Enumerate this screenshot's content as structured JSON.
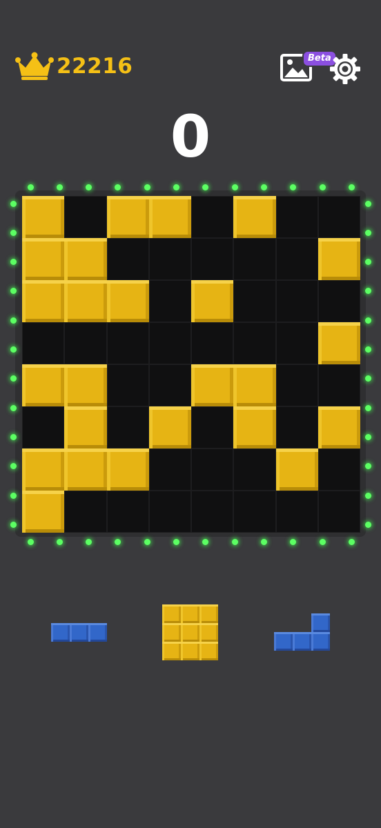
{
  "header": {
    "best_score": "22216",
    "best_icon": "crown-icon",
    "gallery_icon": "image-gallery-icon",
    "beta_badge": "Beta",
    "settings_icon": "gear-icon"
  },
  "current_score": "0",
  "colors": {
    "background": "#3a3a3d",
    "block_yellow": "#e6b414",
    "block_blue": "#3267c9",
    "board_empty": "#101011",
    "led_green": "#5cff63",
    "score_gold": "#f5c016",
    "beta_purple": "#8b4fe0"
  },
  "board": {
    "rows": 8,
    "cols": 8,
    "cells": [
      [
        1,
        0,
        1,
        1,
        0,
        1,
        0,
        0
      ],
      [
        1,
        1,
        0,
        0,
        0,
        0,
        0,
        1
      ],
      [
        1,
        1,
        1,
        0,
        1,
        0,
        0,
        0
      ],
      [
        0,
        0,
        0,
        0,
        0,
        0,
        0,
        1
      ],
      [
        1,
        1,
        0,
        0,
        1,
        1,
        0,
        0
      ],
      [
        0,
        1,
        0,
        1,
        0,
        1,
        0,
        1
      ],
      [
        1,
        1,
        1,
        0,
        0,
        0,
        1,
        0
      ],
      [
        1,
        0,
        0,
        0,
        0,
        0,
        0,
        0
      ]
    ]
  },
  "pieces": [
    {
      "name": "piece-blue-line-3",
      "color": "blue",
      "cells": [
        [
          0,
          0
        ],
        [
          0,
          1
        ],
        [
          0,
          2
        ]
      ]
    },
    {
      "name": "piece-yellow-square-3x3",
      "color": "yellow",
      "cells": [
        [
          0,
          0
        ],
        [
          0,
          1
        ],
        [
          0,
          2
        ],
        [
          1,
          0
        ],
        [
          1,
          1
        ],
        [
          1,
          2
        ],
        [
          2,
          0
        ],
        [
          2,
          1
        ],
        [
          2,
          2
        ]
      ]
    },
    {
      "name": "piece-blue-l-shape",
      "color": "blue",
      "cells": [
        [
          0,
          2
        ],
        [
          1,
          0
        ],
        [
          1,
          1
        ],
        [
          1,
          2
        ]
      ]
    }
  ]
}
